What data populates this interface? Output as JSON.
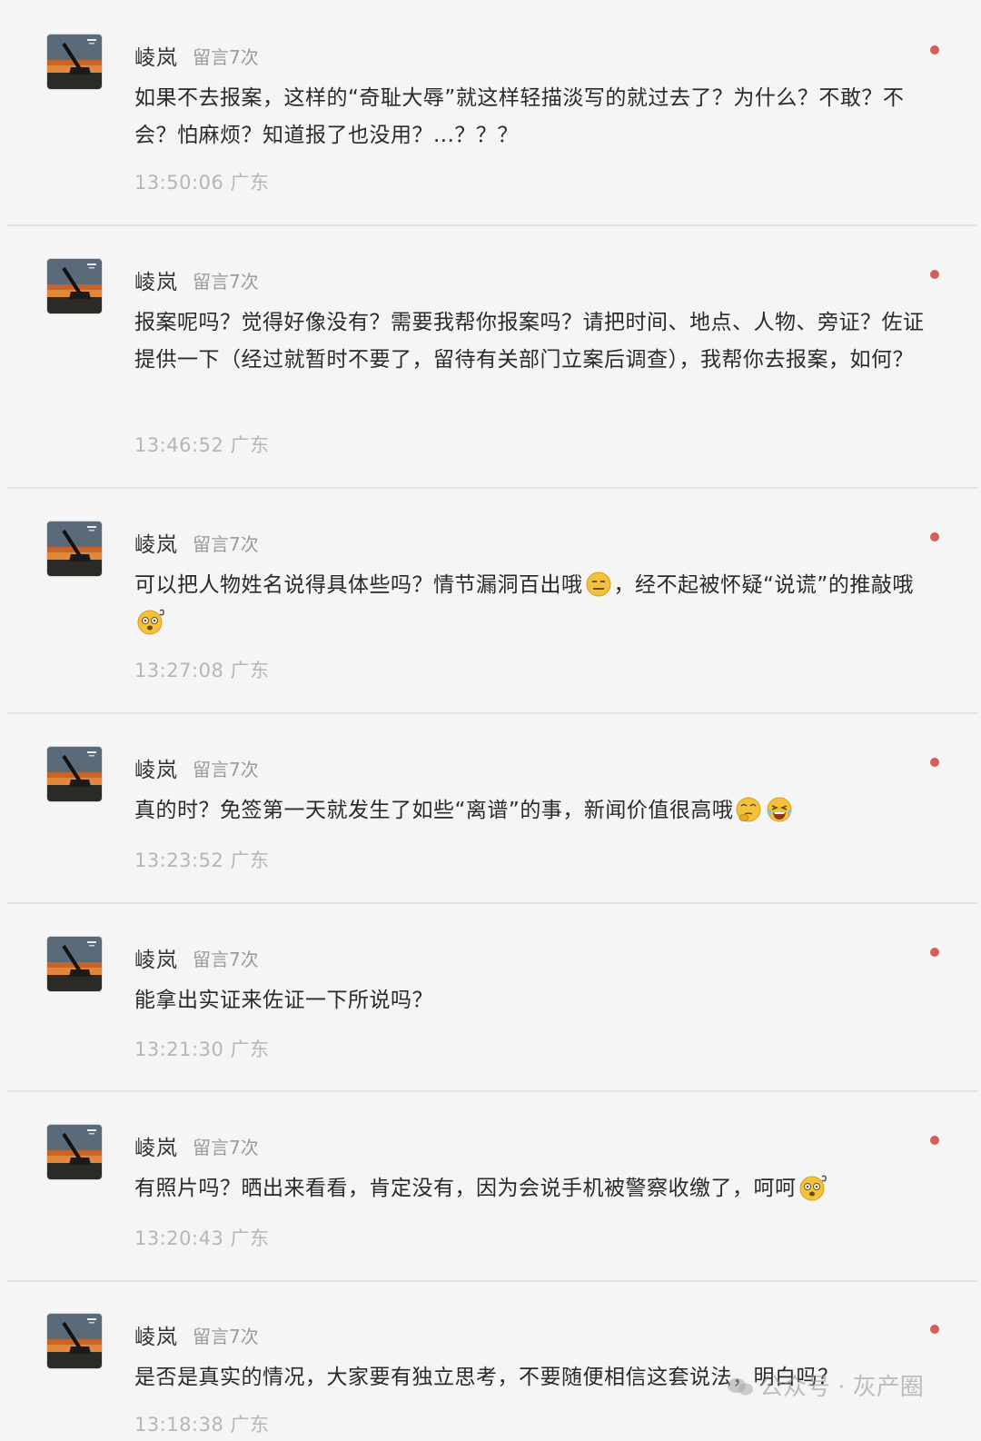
{
  "comments": [
    {
      "author": "崚岚",
      "count": "留言7次",
      "text": "如果不去报案，这样的“奇耻大辱”就这样轻描淡写的就过去了？为什么？不敢？不会？怕麻烦？知道报了也没用？...？？？",
      "time": "13:50:06 广东",
      "emojis": []
    },
    {
      "author": "崚岚",
      "count": "留言7次",
      "text": "报案呢吗？觉得好像没有？需要我帮你报案吗？请把时间、地点、人物、旁证？佐证提供一下（经过就暂时不要了，留待有关部门立案后调查），我帮你去报案，如何？",
      "time": "13:46:52 广东",
      "emojis": []
    },
    {
      "author": "崚岚",
      "count": "留言7次",
      "text_a": "可以把人物姓名说得具体些吗？情节漏洞百出哦",
      "text_b": "，经不起被怀疑“说谎”的推敲哦",
      "time": "13:27:08 广东",
      "emojis": [
        "expressionless-emoji",
        "dizzy-emoji"
      ]
    },
    {
      "author": "崚岚",
      "count": "留言7次",
      "text": "真的时？免签第一天就发生了如些“离谱”的事，新闻价值很高哦",
      "time": "13:23:52 广东",
      "emojis": [
        "thinking-emoji",
        "laughing-emoji"
      ]
    },
    {
      "author": "崚岚",
      "count": "留言7次",
      "text": "能拿出实证来佐证一下所说吗？",
      "time": "13:21:30 广东",
      "emojis": []
    },
    {
      "author": "崚岚",
      "count": "留言7次",
      "text": "有照片吗？晒出来看看，肯定没有，因为会说手机被警察收缴了，呵呵",
      "time": "13:20:43 广东",
      "emojis": [
        "dizzy-emoji"
      ]
    },
    {
      "author": "崚岚",
      "count": "留言7次",
      "text": "是否是真实的情况，大家要有独立思考，不要随便相信这套说法，明白吗？",
      "time": "13:18:38 广东",
      "emojis": []
    }
  ],
  "watermark": "公众号 · 灰产圈",
  "colors": {
    "unread_dot": "#d75c5c",
    "divider": "#e2e2e2",
    "meta_text": "#b6b6b6"
  }
}
